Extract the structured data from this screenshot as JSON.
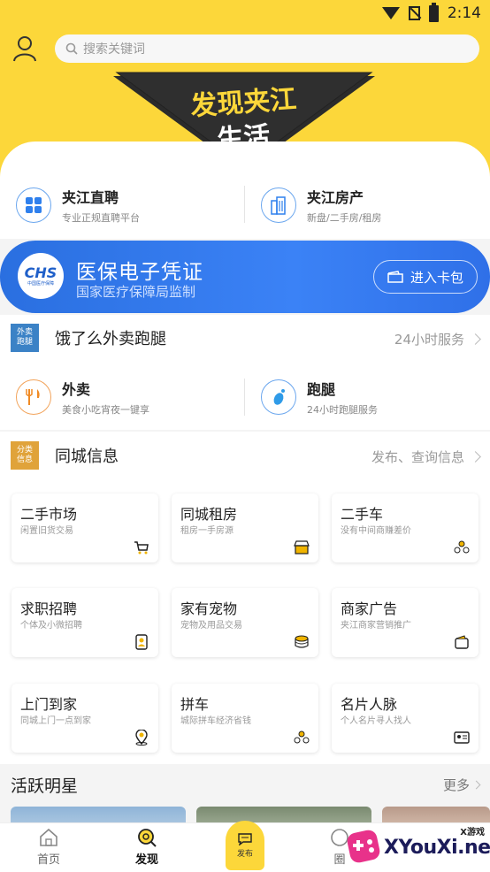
{
  "status_bar": {
    "time": "2:14"
  },
  "search": {
    "placeholder": "搜索关键词"
  },
  "logo": {
    "line1": "发现夹江",
    "line2": "生活"
  },
  "services": [
    {
      "title": "夹江直聘",
      "subtitle": "专业正规直聘平台"
    },
    {
      "title": "夹江房产",
      "subtitle": "新盘/二手房/租房"
    }
  ],
  "banner": {
    "badge": "CHS",
    "badge_sub": "中国医疗保障",
    "title": "医保电子凭证",
    "subtitle": "国家医疗保障局监制",
    "button": "进入卡包"
  },
  "delivery_section": {
    "badge": [
      "外卖",
      "跑腿"
    ],
    "title": "饿了么外卖跑腿",
    "right_text": "24小时服务",
    "items": [
      {
        "title": "外卖",
        "subtitle": "美食小吃宵夜一键享"
      },
      {
        "title": "跑腿",
        "subtitle": "24小时跑腿服务"
      }
    ]
  },
  "city_section": {
    "badge": [
      "分类",
      "信息"
    ],
    "title": "同城信息",
    "right_text": "发布、查询信息"
  },
  "categories": [
    {
      "title": "二手市场",
      "subtitle": "闲置旧货交易",
      "icon": "cart-icon"
    },
    {
      "title": "同城租房",
      "subtitle": "租房一手房源",
      "icon": "shop-icon"
    },
    {
      "title": "二手车",
      "subtitle": "没有中间商赚差价",
      "icon": "people-icon"
    },
    {
      "title": "求职招聘",
      "subtitle": "个体及小微招聘",
      "icon": "contact-icon"
    },
    {
      "title": "家有宠物",
      "subtitle": "宠物及用品交易",
      "icon": "coins-icon"
    },
    {
      "title": "商家广告",
      "subtitle": "夹江商家营销推广",
      "icon": "wallet-icon"
    },
    {
      "title": "上门到家",
      "subtitle": "同城上门一点到家",
      "icon": "location-icon"
    },
    {
      "title": "拼车",
      "subtitle": "城际拼车经济省钱",
      "icon": "people-icon"
    },
    {
      "title": "名片人脉",
      "subtitle": "个人名片寻人找人",
      "icon": "card-icon"
    }
  ],
  "active_stars": {
    "title": "活跃明星",
    "more": "更多"
  },
  "tabbar": {
    "home": "首页",
    "discover": "发现",
    "publish": "发布",
    "circle": "圈"
  },
  "watermark": {
    "small": "X游戏",
    "text": "XYouXi.net"
  },
  "colors": {
    "brand_yellow": "#fcd73a",
    "banner_blue": "#3b82f6"
  }
}
